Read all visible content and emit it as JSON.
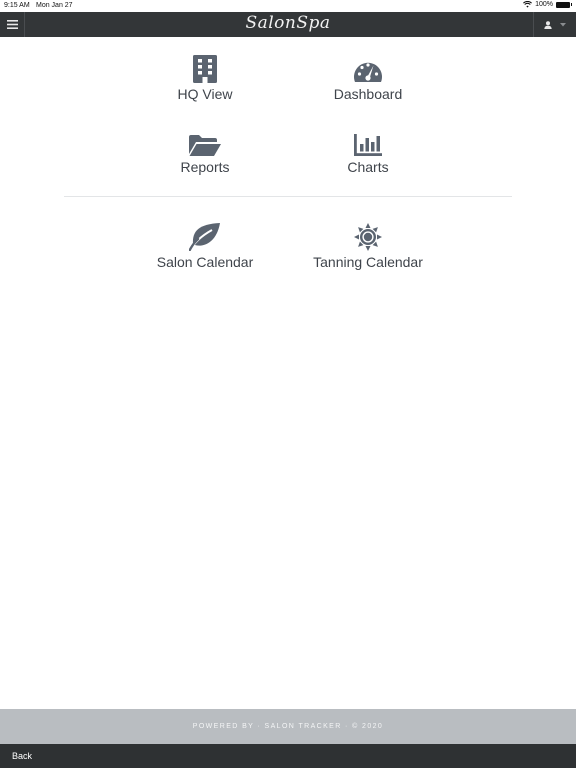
{
  "status": {
    "time": "9:15 AM",
    "date": "Mon Jan 27",
    "battery": "100%"
  },
  "header": {
    "brand": "SalonSpa"
  },
  "tiles": [
    {
      "label": "HQ View",
      "icon": "building-icon"
    },
    {
      "label": "Dashboard",
      "icon": "speedometer-icon"
    },
    {
      "label": "Reports",
      "icon": "folder-open-icon"
    },
    {
      "label": "Charts",
      "icon": "bar-chart-icon"
    },
    {
      "label": "Salon Calendar",
      "icon": "leaf-icon"
    },
    {
      "label": "Tanning Calendar",
      "icon": "sun-icon"
    }
  ],
  "footer": {
    "text": "POWERED BY · SALON TRACKER · © 2020"
  },
  "bottombar": {
    "back_label": "Back"
  },
  "colors": {
    "topbar": "#333638",
    "icon": "#5b6470",
    "footer": "#b9bdc1",
    "bottombar": "#2e3133"
  }
}
